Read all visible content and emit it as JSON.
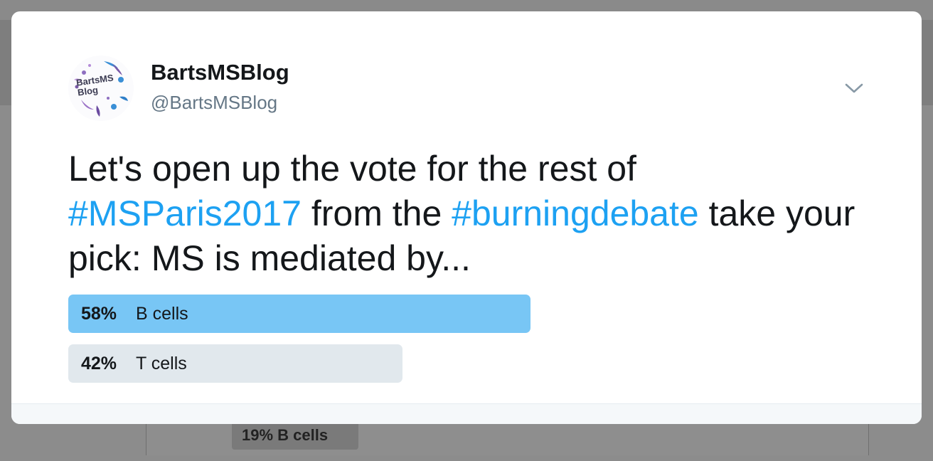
{
  "backdrop": {
    "peek_text": "19%  B cells"
  },
  "author": {
    "display_name": "BartsMSBlog",
    "handle": "@BartsMSBlog",
    "avatar_text_line1": "BartsMS",
    "avatar_text_line2": "Blog"
  },
  "tweet": {
    "text_part1": "Let's open up the vote for the rest of ",
    "hashtag1": "#MSParis2017",
    "text_part2": " from the ",
    "hashtag2": "#burningdebate",
    "text_part3": " take your pick: MS is mediated by..."
  },
  "poll": {
    "options": [
      {
        "percent": "58%",
        "label": "B cells",
        "share": 0.58,
        "leading": true
      },
      {
        "percent": "42%",
        "label": "T cells",
        "share": 0.42,
        "leading": false
      }
    ]
  },
  "colors": {
    "hashtag": "#1da1f2",
    "poll_leader": "#78c6f5",
    "poll_other": "#e1e8ed"
  },
  "icons": {
    "menu": "chevron-down-icon"
  }
}
